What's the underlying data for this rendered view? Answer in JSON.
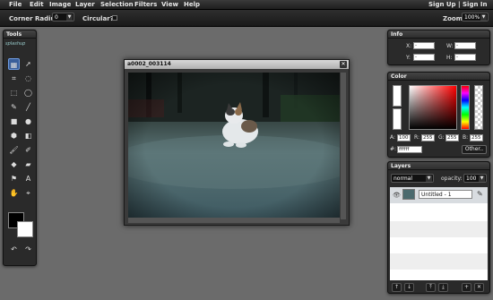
{
  "menu": {
    "items": [
      "File",
      "Edit",
      "Image",
      "Layer",
      "Selection",
      "Filters",
      "View",
      "Help"
    ],
    "sign_up": "Sign Up |",
    "sign_in": "Sign In"
  },
  "options": {
    "corner_radius_label": "Corner Radius:",
    "corner_radius_value": "0",
    "circular_label": "Circular?:",
    "zoom_label": "Zoom:",
    "zoom_value": "100%"
  },
  "tools": {
    "title": "Tools",
    "logo_text": "splashup"
  },
  "document": {
    "title": "a0002_003114"
  },
  "info": {
    "title": "Info",
    "x_label": "X:",
    "y_label": "Y:",
    "w_label": "W:",
    "h_label": "H:",
    "x_value": "-",
    "y_value": "-",
    "w_value": "-",
    "h_value": "-"
  },
  "color": {
    "title": "Color",
    "a_label": "A:",
    "a_value": "100",
    "r_label": "R:",
    "r_value": "255",
    "g_label": "G:",
    "g_value": "255",
    "b_label": "B:",
    "b_value": "255",
    "hex_label": "#:",
    "hex_value": "ffffff",
    "other_button": "Other..",
    "hue_color": "#ff0000"
  },
  "layers": {
    "title": "Layers",
    "blend_mode": "normal",
    "opacity_label": "opacity:",
    "opacity_value": "100",
    "layer_name": "Untitled - 1"
  }
}
